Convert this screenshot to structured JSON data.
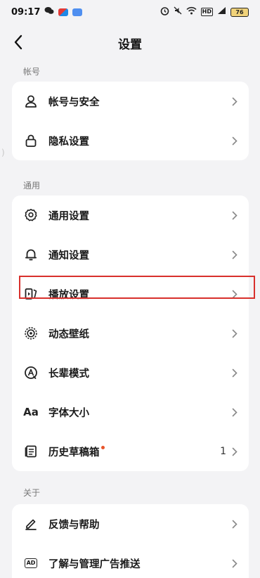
{
  "status_bar": {
    "time": "09:17",
    "battery": "76",
    "hd": "HD"
  },
  "header": {
    "title": "设置",
    "back_icon": "chevron-left-icon"
  },
  "sections": [
    {
      "title": "帐号",
      "items": [
        {
          "label": "帐号与安全",
          "icon": "person-icon"
        },
        {
          "label": "隐私设置",
          "icon": "lock-icon"
        }
      ]
    },
    {
      "title": "通用",
      "items": [
        {
          "label": "通用设置",
          "icon": "gear-icon"
        },
        {
          "label": "通知设置",
          "icon": "bell-icon"
        },
        {
          "label": "播放设置",
          "icon": "play-settings-icon"
        },
        {
          "label": "动态壁纸",
          "icon": "wallpaper-icon"
        },
        {
          "label": "长辈模式",
          "icon": "elder-mode-icon"
        },
        {
          "label": "字体大小",
          "icon": "font-size-icon",
          "icon_text": "Aa"
        },
        {
          "label": "历史草稿箱",
          "icon": "drafts-icon",
          "count": "1",
          "has_dot": true
        }
      ]
    },
    {
      "title": "关于",
      "items": [
        {
          "label": "反馈与帮助",
          "icon": "pen-icon"
        },
        {
          "label": "了解与管理广告推送",
          "icon": "ad-icon",
          "icon_text": "AD"
        }
      ]
    }
  ],
  "colors": {
    "background": "#f3f3f5",
    "card": "#ffffff",
    "highlight_border": "#d8302c",
    "dot": "#e8542a"
  }
}
